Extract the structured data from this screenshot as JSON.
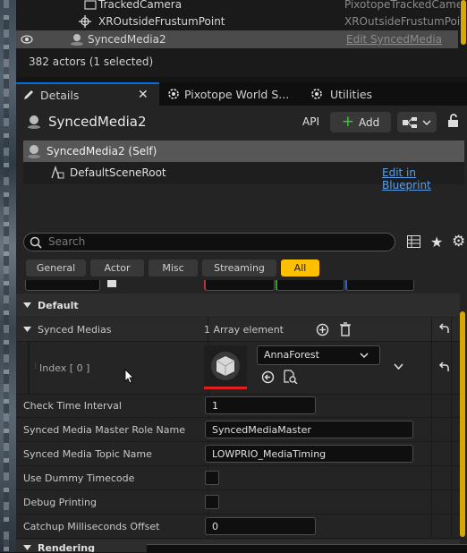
{
  "outliner": {
    "rows": [
      {
        "name": "TrackedCamera",
        "type": "PixotopeTrackedCame"
      },
      {
        "name": "XROutsideFrustumPoint",
        "type": "XROutsideFrustumPoi"
      },
      {
        "name": "SyncedMedia2",
        "type": "Edit SyncedMedia"
      }
    ],
    "status": "382 actors (1 selected)"
  },
  "tabs": [
    {
      "label": "Details",
      "icon": "pencil-icon"
    },
    {
      "label": "Pixotope World S...",
      "icon": "gear-icon"
    },
    {
      "label": "Utilities",
      "icon": "gear-icon"
    }
  ],
  "header": {
    "actor_name": "SyncedMedia2",
    "api_label": "API",
    "add_label": "Add"
  },
  "components": {
    "root": "SyncedMedia2 (Self)",
    "child": "DefaultSceneRoot",
    "edit_link": "Edit in Blueprint"
  },
  "search": {
    "placeholder": "Search"
  },
  "filters": [
    "General",
    "Actor",
    "Misc",
    "Streaming",
    "All"
  ],
  "sections": {
    "default": "Default",
    "rendering": "Rendering"
  },
  "synced_medias": {
    "label": "Synced Medias",
    "count": "1 Array element",
    "index_label": "Index [ 0 ]",
    "asset": "AnnaForest"
  },
  "properties": [
    {
      "label": "Check Time Interval",
      "value": "1"
    },
    {
      "label": "Synced Media Master Role Name",
      "value": "SyncedMediaMaster"
    },
    {
      "label": "Synced Media Topic Name",
      "value": "LOWPRIO_MediaTiming"
    },
    {
      "label": "Use Dummy Timecode",
      "value": ""
    },
    {
      "label": "Debug Printing",
      "value": ""
    },
    {
      "label": "Catchup Milliseconds Offset",
      "value": "0"
    }
  ],
  "colors": {
    "accent": "#0070e0",
    "active_filter": "#ffc000",
    "link": "#5b9ee8",
    "asset_underline": "#e02020"
  }
}
